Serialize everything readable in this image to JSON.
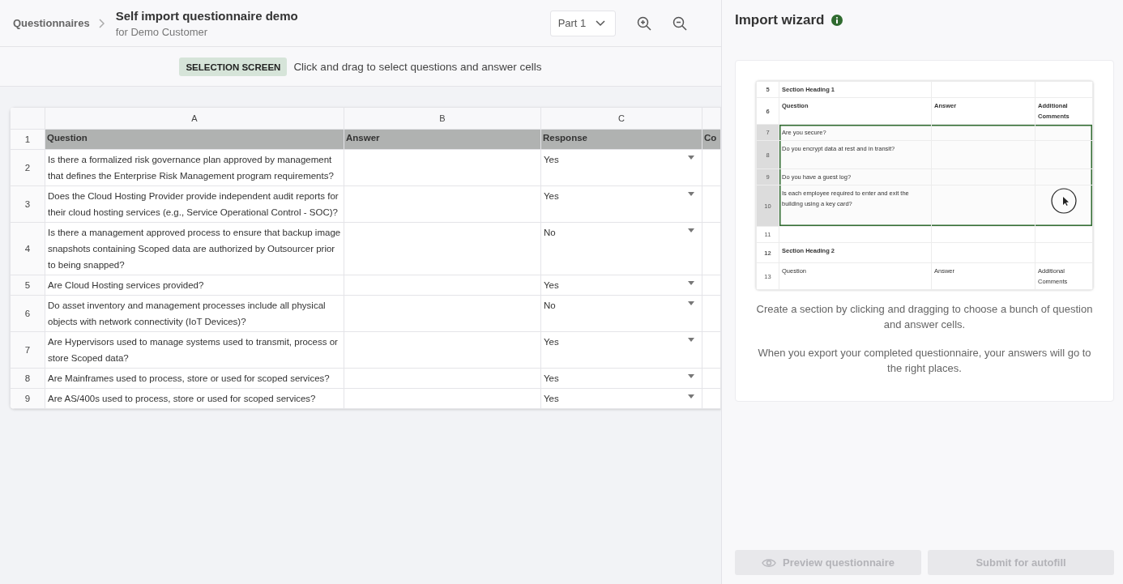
{
  "header": {
    "breadcrumb": "Questionnaires",
    "title": "Self import questionnaire demo",
    "subtitle": "for Demo Customer",
    "part_select": {
      "value": "Part 1"
    }
  },
  "selection_bar": {
    "badge": "SELECTION SCREEN",
    "hint": "Click and drag to select questions and answer cells"
  },
  "sheet": {
    "columns": [
      "A",
      "B",
      "C"
    ],
    "rows": [
      {
        "number": "1",
        "kind": "header",
        "cells": [
          "Question",
          "Answer",
          "Response",
          "Co"
        ]
      },
      {
        "number": "2",
        "question": "Is there a formalized risk governance plan approved by management that defines the Enterprise Risk Management program requirements?",
        "response": "Yes"
      },
      {
        "number": "3",
        "question": "Does the Cloud Hosting Provider provide independent audit reports for their cloud hosting services (e.g., Service Operational Control - SOC)?",
        "response": "Yes"
      },
      {
        "number": "4",
        "question": "Is there a management approved process to ensure that backup image snapshots containing Scoped data are authorized by Outsourcer prior to being snapped?",
        "response": "No"
      },
      {
        "number": "5",
        "question": "Are Cloud Hosting services provided?",
        "response": "Yes"
      },
      {
        "number": "6",
        "question": "Do asset inventory and management processes include all physical objects with network connectivity (IoT Devices)?",
        "response": "No"
      },
      {
        "number": "7",
        "question": "Are Hypervisors used to manage systems used to transmit, process or store Scoped data?",
        "response": "Yes"
      },
      {
        "number": "8",
        "question": "Are Mainframes used to process, store or used for scoped services?",
        "response": "Yes"
      },
      {
        "number": "9",
        "question": "Are AS/400s used to process, store or used for scoped services?",
        "response": "Yes"
      }
    ]
  },
  "wizard": {
    "title": "Import wizard",
    "preview": {
      "rows": [
        {
          "number": "5",
          "kind": "heading",
          "selected": false,
          "cells": [
            "Section Heading 1"
          ]
        },
        {
          "number": "6",
          "kind": "heading",
          "selected": false,
          "cells": [
            "Question",
            "Answer",
            "Additional Comments"
          ]
        },
        {
          "number": "7",
          "kind": "plain",
          "selected": true,
          "cells": [
            "Are you secure?"
          ]
        },
        {
          "number": "8",
          "kind": "plain",
          "selected": true,
          "cells": [
            "Do you encrypt data at rest and in transit?"
          ]
        },
        {
          "number": "9",
          "kind": "plain",
          "selected": true,
          "cells": [
            "Do you have a guest log?"
          ]
        },
        {
          "number": "10",
          "kind": "plain",
          "selected": true,
          "cells": [
            "Is each employee required to enter and exit the building using a key card?"
          ]
        },
        {
          "number": "11",
          "kind": "plain",
          "selected": false
        },
        {
          "number": "12",
          "kind": "heading",
          "selected": false,
          "cells": [
            "Section Heading 2"
          ]
        },
        {
          "number": "13",
          "kind": "plain",
          "selected": false,
          "cells": [
            "Question",
            "Answer",
            "Additional Comments"
          ]
        }
      ]
    },
    "paragraphs": [
      "Create a section by clicking and dragging to choose a bunch of question and answer cells.",
      "When you export your completed questionnaire, your answers will go to the right places."
    ],
    "buttons": [
      {
        "kind": "preview",
        "label": "Preview questionnaire",
        "disabled": true
      },
      {
        "kind": "submit",
        "label": "Submit for autofill",
        "disabled": true
      }
    ]
  }
}
